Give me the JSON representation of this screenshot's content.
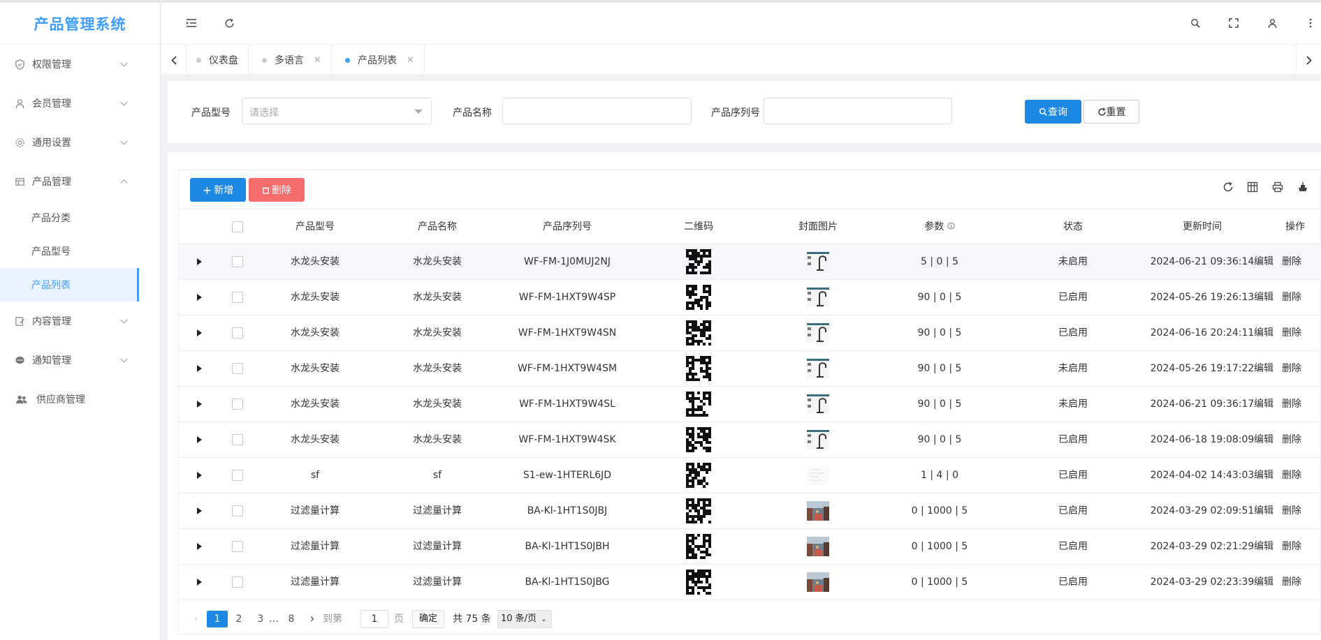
{
  "app": {
    "title": "产品管理系统"
  },
  "sidebar": {
    "items": [
      {
        "label": "权限管理",
        "icon": "shield-icon",
        "expanded": false
      },
      {
        "label": "会员管理",
        "icon": "user-icon",
        "expanded": false
      },
      {
        "label": "通用设置",
        "icon": "gear-icon",
        "expanded": false
      },
      {
        "label": "产品管理",
        "icon": "table-icon",
        "expanded": true,
        "children": [
          "产品分类",
          "产品型号",
          "产品列表"
        ],
        "active_child": "产品列表"
      },
      {
        "label": "内容管理",
        "icon": "edit-doc-icon",
        "expanded": false
      },
      {
        "label": "通知管理",
        "icon": "chat-icon",
        "expanded": false
      },
      {
        "label": "供应商管理",
        "icon": "team-icon"
      }
    ]
  },
  "topbar": {
    "icons": [
      "menu-fold-icon",
      "refresh-icon",
      "search-icon",
      "fullscreen-icon",
      "user-icon",
      "more-icon"
    ]
  },
  "tabs": [
    {
      "label": "仪表盘",
      "closable": false,
      "active": false
    },
    {
      "label": "多语言",
      "closable": true,
      "active": false
    },
    {
      "label": "产品列表",
      "closable": true,
      "active": true
    }
  ],
  "search": {
    "model_label": "产品型号",
    "model_placeholder": "请选择",
    "name_label": "产品名称",
    "name_value": "",
    "serial_label": "产品序列号",
    "serial_value": "",
    "query_label": "查询",
    "reset_label": "重置"
  },
  "toolbar": {
    "add_label": "新增",
    "delete_label": "删除"
  },
  "table": {
    "columns": [
      "产品型号",
      "产品名称",
      "产品序列号",
      "二维码",
      "封面图片",
      "参数",
      "状态",
      "更新时间",
      "操作"
    ],
    "edit_label": "编辑",
    "delete_label": "删除",
    "rows": [
      {
        "model": "水龙头安装",
        "name": "水龙头安装",
        "serial": "WF-FM-1J0MUJ2NJ",
        "params": "5 | 0 | 5",
        "status": "未启用",
        "updated": "2024-06-21 09:36:14",
        "cover": "faucet"
      },
      {
        "model": "水龙头安装",
        "name": "水龙头安装",
        "serial": "WF-FM-1HXT9W4SP",
        "params": "90 | 0 | 5",
        "status": "已启用",
        "updated": "2024-05-26 19:26:13",
        "cover": "faucet"
      },
      {
        "model": "水龙头安装",
        "name": "水龙头安装",
        "serial": "WF-FM-1HXT9W4SN",
        "params": "90 | 0 | 5",
        "status": "已启用",
        "updated": "2024-06-16 20:24:11",
        "cover": "faucet"
      },
      {
        "model": "水龙头安装",
        "name": "水龙头安装",
        "serial": "WF-FM-1HXT9W4SM",
        "params": "90 | 0 | 5",
        "status": "未启用",
        "updated": "2024-05-26 19:17:22",
        "cover": "faucet"
      },
      {
        "model": "水龙头安装",
        "name": "水龙头安装",
        "serial": "WF-FM-1HXT9W4SL",
        "params": "90 | 0 | 5",
        "status": "未启用",
        "updated": "2024-06-21 09:36:17",
        "cover": "faucet"
      },
      {
        "model": "水龙头安装",
        "name": "水龙头安装",
        "serial": "WF-FM-1HXT9W4SK",
        "params": "90 | 0 | 5",
        "status": "已启用",
        "updated": "2024-06-18 19:08:09",
        "cover": "faucet"
      },
      {
        "model": "sf",
        "name": "sf",
        "serial": "S1-ew-1HTERL6JD",
        "params": "1 | 4 | 0",
        "status": "已启用",
        "updated": "2024-04-02 14:43:03",
        "cover": "doc"
      },
      {
        "model": "过滤量计算",
        "name": "过滤量计算",
        "serial": "BA-Kl-1HT1S0JBJ",
        "params": "0 | 1000 | 5",
        "status": "已启用",
        "updated": "2024-03-29 02:09:51",
        "cover": "street"
      },
      {
        "model": "过滤量计算",
        "name": "过滤量计算",
        "serial": "BA-Kl-1HT1S0JBH",
        "params": "0 | 1000 | 5",
        "status": "已启用",
        "updated": "2024-03-29 02:21:29",
        "cover": "street"
      },
      {
        "model": "过滤量计算",
        "name": "过滤量计算",
        "serial": "BA-Kl-1HT1S0JBG",
        "params": "0 | 1000 | 5",
        "status": "已启用",
        "updated": "2024-03-29 02:23:39",
        "cover": "street"
      }
    ]
  },
  "pagination": {
    "pages": [
      "1",
      "2",
      "3",
      "…",
      "8"
    ],
    "current": "1",
    "goto_label": "到第",
    "goto_value": "1",
    "page_unit": "页",
    "confirm_label": "确定",
    "total_label": "共 75 条",
    "page_size": "10 条/页"
  },
  "colors": {
    "primary": "#1e88e5",
    "danger": "#f56c6c",
    "brand": "#409eff"
  }
}
